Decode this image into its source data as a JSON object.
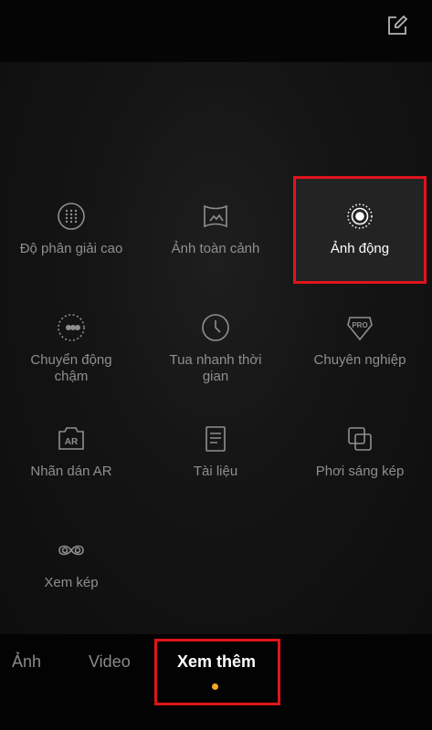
{
  "modes": [
    {
      "label": "Độ phân giải cao",
      "icon": "high-resolution-icon"
    },
    {
      "label": "Ảnh toàn cảnh",
      "icon": "panorama-icon"
    },
    {
      "label": "Ảnh động",
      "icon": "live-photo-icon",
      "active": true
    },
    {
      "label": "Chuyển động chậm",
      "icon": "slow-motion-icon"
    },
    {
      "label": "Tua nhanh thời gian",
      "icon": "timelapse-icon"
    },
    {
      "label": "Chuyên nghiệp",
      "icon": "pro-mode-icon"
    },
    {
      "label": "Nhãn dán AR",
      "icon": "ar-sticker-icon"
    },
    {
      "label": "Tài liệu",
      "icon": "document-icon"
    },
    {
      "label": "Phơi sáng kép",
      "icon": "double-exposure-icon"
    },
    {
      "label": "Xem kép",
      "icon": "dual-view-icon"
    }
  ],
  "tabs": [
    {
      "label": "Ảnh"
    },
    {
      "label": "Video"
    },
    {
      "label": "Xem thêm",
      "active": true
    }
  ],
  "colors": {
    "highlight": "#e0141b",
    "indicator": "#f5a623",
    "active_text": "#ffffff",
    "inactive_text": "#8f8f8f"
  }
}
